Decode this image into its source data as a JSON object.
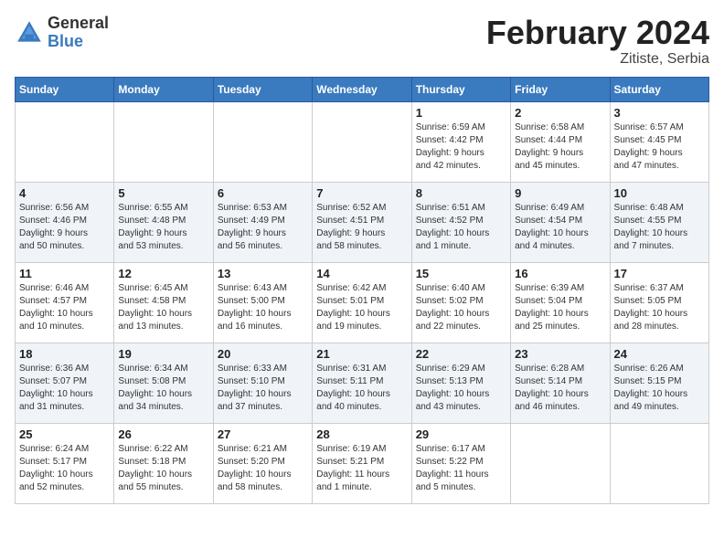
{
  "header": {
    "logo_general": "General",
    "logo_blue": "Blue",
    "month_title": "February 2024",
    "subtitle": "Zitiste, Serbia"
  },
  "days_of_week": [
    "Sunday",
    "Monday",
    "Tuesday",
    "Wednesday",
    "Thursday",
    "Friday",
    "Saturday"
  ],
  "weeks": [
    [
      {
        "day": "",
        "info": ""
      },
      {
        "day": "",
        "info": ""
      },
      {
        "day": "",
        "info": ""
      },
      {
        "day": "",
        "info": ""
      },
      {
        "day": "1",
        "info": "Sunrise: 6:59 AM\nSunset: 4:42 PM\nDaylight: 9 hours\nand 42 minutes."
      },
      {
        "day": "2",
        "info": "Sunrise: 6:58 AM\nSunset: 4:44 PM\nDaylight: 9 hours\nand 45 minutes."
      },
      {
        "day": "3",
        "info": "Sunrise: 6:57 AM\nSunset: 4:45 PM\nDaylight: 9 hours\nand 47 minutes."
      }
    ],
    [
      {
        "day": "4",
        "info": "Sunrise: 6:56 AM\nSunset: 4:46 PM\nDaylight: 9 hours\nand 50 minutes."
      },
      {
        "day": "5",
        "info": "Sunrise: 6:55 AM\nSunset: 4:48 PM\nDaylight: 9 hours\nand 53 minutes."
      },
      {
        "day": "6",
        "info": "Sunrise: 6:53 AM\nSunset: 4:49 PM\nDaylight: 9 hours\nand 56 minutes."
      },
      {
        "day": "7",
        "info": "Sunrise: 6:52 AM\nSunset: 4:51 PM\nDaylight: 9 hours\nand 58 minutes."
      },
      {
        "day": "8",
        "info": "Sunrise: 6:51 AM\nSunset: 4:52 PM\nDaylight: 10 hours\nand 1 minute."
      },
      {
        "day": "9",
        "info": "Sunrise: 6:49 AM\nSunset: 4:54 PM\nDaylight: 10 hours\nand 4 minutes."
      },
      {
        "day": "10",
        "info": "Sunrise: 6:48 AM\nSunset: 4:55 PM\nDaylight: 10 hours\nand 7 minutes."
      }
    ],
    [
      {
        "day": "11",
        "info": "Sunrise: 6:46 AM\nSunset: 4:57 PM\nDaylight: 10 hours\nand 10 minutes."
      },
      {
        "day": "12",
        "info": "Sunrise: 6:45 AM\nSunset: 4:58 PM\nDaylight: 10 hours\nand 13 minutes."
      },
      {
        "day": "13",
        "info": "Sunrise: 6:43 AM\nSunset: 5:00 PM\nDaylight: 10 hours\nand 16 minutes."
      },
      {
        "day": "14",
        "info": "Sunrise: 6:42 AM\nSunset: 5:01 PM\nDaylight: 10 hours\nand 19 minutes."
      },
      {
        "day": "15",
        "info": "Sunrise: 6:40 AM\nSunset: 5:02 PM\nDaylight: 10 hours\nand 22 minutes."
      },
      {
        "day": "16",
        "info": "Sunrise: 6:39 AM\nSunset: 5:04 PM\nDaylight: 10 hours\nand 25 minutes."
      },
      {
        "day": "17",
        "info": "Sunrise: 6:37 AM\nSunset: 5:05 PM\nDaylight: 10 hours\nand 28 minutes."
      }
    ],
    [
      {
        "day": "18",
        "info": "Sunrise: 6:36 AM\nSunset: 5:07 PM\nDaylight: 10 hours\nand 31 minutes."
      },
      {
        "day": "19",
        "info": "Sunrise: 6:34 AM\nSunset: 5:08 PM\nDaylight: 10 hours\nand 34 minutes."
      },
      {
        "day": "20",
        "info": "Sunrise: 6:33 AM\nSunset: 5:10 PM\nDaylight: 10 hours\nand 37 minutes."
      },
      {
        "day": "21",
        "info": "Sunrise: 6:31 AM\nSunset: 5:11 PM\nDaylight: 10 hours\nand 40 minutes."
      },
      {
        "day": "22",
        "info": "Sunrise: 6:29 AM\nSunset: 5:13 PM\nDaylight: 10 hours\nand 43 minutes."
      },
      {
        "day": "23",
        "info": "Sunrise: 6:28 AM\nSunset: 5:14 PM\nDaylight: 10 hours\nand 46 minutes."
      },
      {
        "day": "24",
        "info": "Sunrise: 6:26 AM\nSunset: 5:15 PM\nDaylight: 10 hours\nand 49 minutes."
      }
    ],
    [
      {
        "day": "25",
        "info": "Sunrise: 6:24 AM\nSunset: 5:17 PM\nDaylight: 10 hours\nand 52 minutes."
      },
      {
        "day": "26",
        "info": "Sunrise: 6:22 AM\nSunset: 5:18 PM\nDaylight: 10 hours\nand 55 minutes."
      },
      {
        "day": "27",
        "info": "Sunrise: 6:21 AM\nSunset: 5:20 PM\nDaylight: 10 hours\nand 58 minutes."
      },
      {
        "day": "28",
        "info": "Sunrise: 6:19 AM\nSunset: 5:21 PM\nDaylight: 11 hours\nand 1 minute."
      },
      {
        "day": "29",
        "info": "Sunrise: 6:17 AM\nSunset: 5:22 PM\nDaylight: 11 hours\nand 5 minutes."
      },
      {
        "day": "",
        "info": ""
      },
      {
        "day": "",
        "info": ""
      }
    ]
  ]
}
